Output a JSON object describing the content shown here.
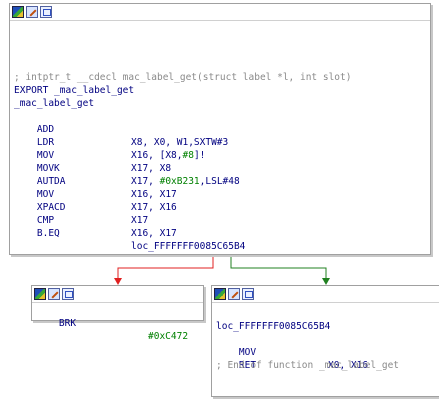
{
  "main_block": {
    "header_comment": "; intptr_t __cdecl mac_label_get(struct label *l, int slot)",
    "export_line": "EXPORT _mac_label_get",
    "label": "_mac_label_get",
    "instructions": [
      {
        "mnemonic": "ADD",
        "operands": "X8, X0, W1,SXTW#3"
      },
      {
        "mnemonic": "LDR",
        "op_pre": "X16, [X8,",
        "op_num": "#8",
        "op_post": "]!"
      },
      {
        "mnemonic": "MOV",
        "operands": "X17, X8"
      },
      {
        "mnemonic": "MOVK",
        "op_pre": "X17, ",
        "op_num": "#0xB231",
        "op_post": ",LSL#48"
      },
      {
        "mnemonic": "AUTDA",
        "operands": "X16, X17"
      },
      {
        "mnemonic": "MOV",
        "operands": "X17, X16"
      },
      {
        "mnemonic": "XPACD",
        "operands": "X17"
      },
      {
        "mnemonic": "CMP",
        "operands": "X16, X17"
      },
      {
        "mnemonic": "B.EQ",
        "operands": "loc_FFFFFFF0085C65B4"
      }
    ]
  },
  "brk_block": {
    "mnemonic": "BRK",
    "operand": "#0xC472"
  },
  "target_block": {
    "label": "loc_FFFFFFF0085C65B4",
    "instructions": [
      {
        "mnemonic": "MOV",
        "operands": "X0, X16"
      },
      {
        "mnemonic": "RET",
        "operands": ""
      }
    ],
    "end_comment": "; End of function _mac_label_get"
  },
  "colors": {
    "code": "#000080",
    "number": "#008000",
    "comment": "#8a8a8a",
    "false_edge": "#e02020",
    "true_edge": "#208020"
  }
}
